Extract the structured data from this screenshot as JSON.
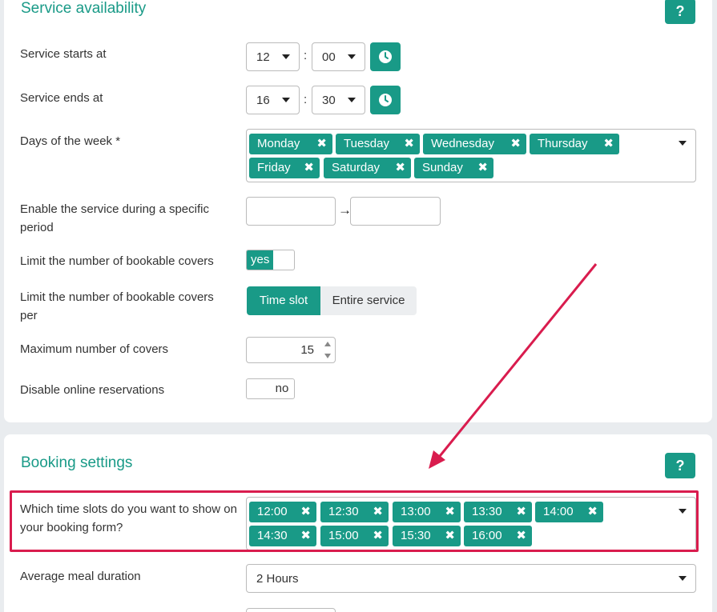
{
  "availability": {
    "title": "Service availability",
    "help_label": "?",
    "starts_label": "Service starts at",
    "starts_hour": "12",
    "starts_minute": "00",
    "ends_label": "Service ends at",
    "ends_hour": "16",
    "ends_minute": "30",
    "colon": ":",
    "days_label": "Days of the week *",
    "days": [
      "Monday",
      "Tuesday",
      "Wednesday",
      "Thursday",
      "Friday",
      "Saturday",
      "Sunday"
    ],
    "period_label": "Enable the service during a specific period",
    "period_arrow": "→",
    "limit_label": "Limit the number of bookable covers",
    "limit_value": "yes",
    "limit_per_label": "Limit the number of bookable covers per",
    "limit_per_options": [
      "Time slot",
      "Entire service"
    ],
    "limit_per_selected": "Time slot",
    "max_covers_label": "Maximum number of covers",
    "max_covers_value": "15",
    "disable_online_label": "Disable online reservations",
    "disable_online_value": "no"
  },
  "booking": {
    "title": "Booking settings",
    "help_label": "?",
    "slots_label": "Which time slots do you want to show on your booking form?",
    "slots": [
      "12:00",
      "12:30",
      "13:00",
      "13:30",
      "14:00",
      "14:30",
      "15:00",
      "15:30",
      "16:00"
    ],
    "meal_label": "Average meal duration",
    "meal_value": "2 Hours"
  },
  "tag_remove_glyph": "✖",
  "colors": {
    "accent": "#199a87",
    "annotation": "#d91c4e"
  }
}
